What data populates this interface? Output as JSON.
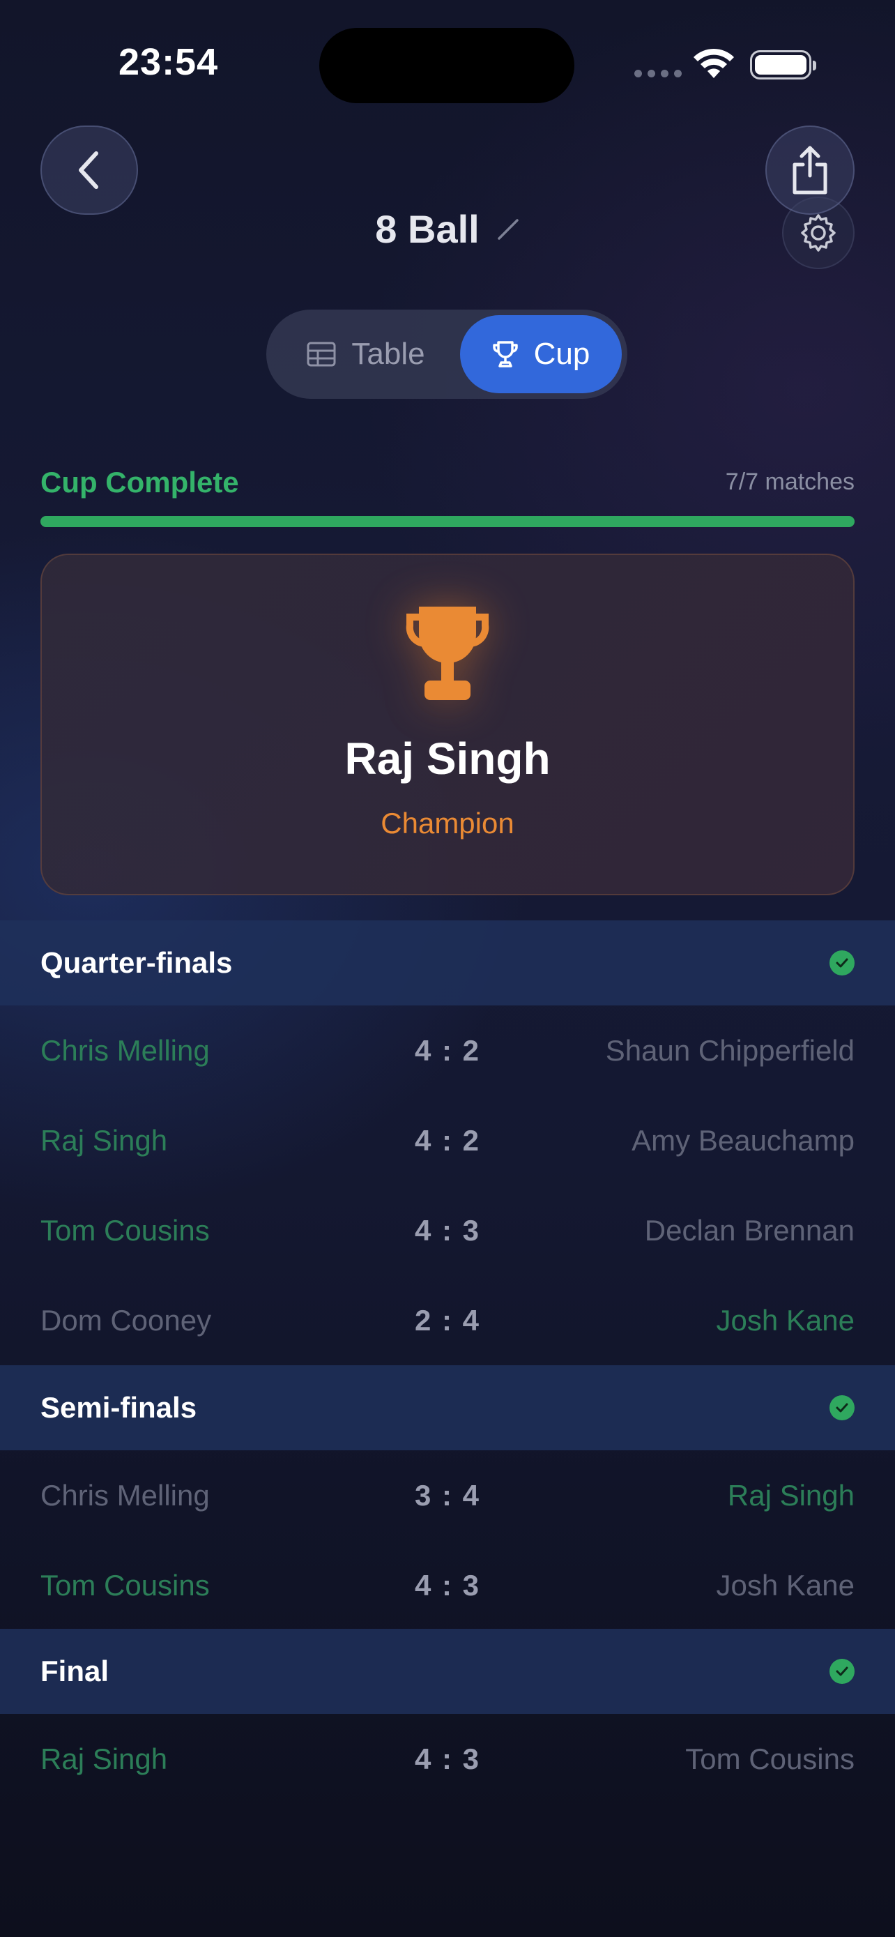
{
  "status_bar": {
    "time": "23:54"
  },
  "header": {
    "title": "8 Ball"
  },
  "segment": {
    "table_label": "Table",
    "cup_label": "Cup",
    "selected": "Cup"
  },
  "progress": {
    "label": "Cup Complete",
    "count": "7/7 matches",
    "completed": 7,
    "total": 7
  },
  "champion": {
    "name": "Raj Singh",
    "label": "Champion"
  },
  "colors": {
    "accent": "#3268db",
    "success": "#2fa85f",
    "champion": "#ea8a34"
  },
  "rounds": [
    {
      "title": "Quarter-finals",
      "matches": [
        {
          "p1": "Chris Melling",
          "score": "4 : 2",
          "p2": "Shaun Chipperfield",
          "winner": "p1"
        },
        {
          "p1": "Raj Singh",
          "score": "4 : 2",
          "p2": "Amy Beauchamp",
          "winner": "p1"
        },
        {
          "p1": "Tom Cousins",
          "score": "4 : 3",
          "p2": "Declan Brennan",
          "winner": "p1"
        },
        {
          "p1": "Dom Cooney",
          "score": "2 : 4",
          "p2": "Josh Kane",
          "winner": "p2"
        }
      ]
    },
    {
      "title": "Semi-finals",
      "matches": [
        {
          "p1": "Chris Melling",
          "score": "3 : 4",
          "p2": "Raj Singh",
          "winner": "p2"
        },
        {
          "p1": "Tom Cousins",
          "score": "4 : 3",
          "p2": "Josh Kane",
          "winner": "p1"
        }
      ]
    },
    {
      "title": "Final",
      "matches": [
        {
          "p1": "Raj Singh",
          "score": "4 : 3",
          "p2": "Tom Cousins",
          "winner": "p1"
        }
      ]
    }
  ]
}
